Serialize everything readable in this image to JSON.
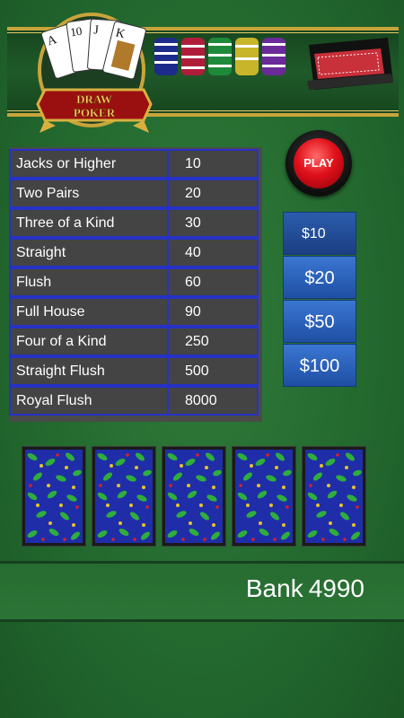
{
  "header": {
    "logo_text": "DRAW POKER",
    "logo_cards": [
      "A",
      "10",
      "J",
      "K"
    ]
  },
  "paytable": {
    "rows": [
      {
        "hand": "Jacks or Higher",
        "payout": "10"
      },
      {
        "hand": "Two Pairs",
        "payout": "20"
      },
      {
        "hand": "Three of a Kind",
        "payout": "30"
      },
      {
        "hand": "Straight",
        "payout": "40"
      },
      {
        "hand": "Flush",
        "payout": "60"
      },
      {
        "hand": "Full House",
        "payout": "90"
      },
      {
        "hand": "Four of a Kind",
        "payout": "250"
      },
      {
        "hand": "Straight Flush",
        "payout": "500"
      },
      {
        "hand": "Royal Flush",
        "payout": "8000"
      }
    ]
  },
  "play_button": {
    "label": "PLAY"
  },
  "bets": [
    {
      "label": "$10",
      "selected": true
    },
    {
      "label": "$20",
      "selected": false
    },
    {
      "label": "$50",
      "selected": false
    },
    {
      "label": "$100",
      "selected": false
    }
  ],
  "cards": {
    "count": 5,
    "face": "back"
  },
  "bank": {
    "label": "Bank",
    "amount": "4990"
  },
  "colors": {
    "felt": "#246a2f",
    "table_border": "#2631c6",
    "bet_button": "#2b5cad",
    "play_red": "#e0101a",
    "gold": "#c9a43a"
  }
}
